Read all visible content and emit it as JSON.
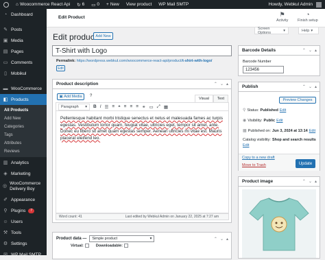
{
  "adminbar": {
    "site_name": "Woocommerce React Api",
    "updates_count": "6",
    "comments_count": "0",
    "new_label": "New",
    "view_product": "View product",
    "mail_plugin": "WP Mail SMTP",
    "howdy": "Howdy, Webkul Admin"
  },
  "sidebar": {
    "items": [
      {
        "label": "Dashboard",
        "icon": "dashboard-icon"
      },
      {
        "label": "Posts",
        "icon": "pin-icon"
      },
      {
        "label": "Media",
        "icon": "media-icon"
      },
      {
        "label": "Pages",
        "icon": "page-icon"
      },
      {
        "label": "Comments",
        "icon": "comment-icon"
      },
      {
        "label": "Mobikul",
        "icon": "mobikul-icon"
      },
      {
        "label": "WooCommerce",
        "icon": "woo-icon"
      },
      {
        "label": "Products",
        "icon": "products-icon"
      }
    ],
    "submenu": [
      "All Products",
      "Add New",
      "Categories",
      "Tags",
      "Attributes",
      "Reviews"
    ],
    "items_after": [
      {
        "label": "Analytics",
        "icon": "analytics-icon"
      },
      {
        "label": "Marketing",
        "icon": "marketing-icon"
      },
      {
        "label": "WooCommerce Delivery Boy",
        "icon": "delivery-icon"
      },
      {
        "label": "Appearance",
        "icon": "appearance-icon"
      },
      {
        "label": "Plugins",
        "icon": "plugins-icon",
        "badge": "7"
      },
      {
        "label": "Users",
        "icon": "users-icon"
      },
      {
        "label": "Tools",
        "icon": "tools-icon"
      },
      {
        "label": "Settings",
        "icon": "settings-icon"
      },
      {
        "label": "WP Mail SMTP",
        "icon": "mail-icon"
      }
    ]
  },
  "topbar": {
    "title": "Edit Product",
    "activity": "Activity",
    "finish_setup": "Finish setup"
  },
  "page": {
    "heading": "Edit product",
    "add_new": "Add New",
    "screen_options": "Screen Options",
    "help": "Help"
  },
  "post": {
    "title": "T-Shirt with Logo",
    "permalink_label": "Permalink:",
    "permalink_base": "https://wordpress.webkul.com/woocommerce-react-api/product/",
    "permalink_slug": "t-shirt-with-logo/",
    "edit_label": "Edit"
  },
  "description": {
    "heading": "Product description",
    "add_media": "Add Media",
    "tab_visual": "Visual",
    "tab_code": "Text",
    "format": "Paragraph",
    "body": "Pellentesque habitant morbi tristique senectus et netus et malesuada fames ac turpis egestas. Vestibulum tortor quam, feugiat vitae, ultricies eget, tempor sit amet, ante. Donec eu libero sit amet quam egestas semper. Aenean ultricies mi vitae est. Mauris placerat eleifend leo.",
    "word_count": "Word count: 41",
    "last_edited": "Last edited by Webkul Admin on January 22, 2025 at 7:27 am"
  },
  "product_data": {
    "label": "Product data —",
    "type": "Simple product",
    "virtual": "Virtual:",
    "downloadable": "Downloadable:"
  },
  "barcode": {
    "heading": "Barcode Details",
    "field_label": "Barcode Number",
    "value": "123456"
  },
  "publish": {
    "heading": "Publish",
    "preview": "Preview Changes",
    "status_label": "Status:",
    "status_value": "Published",
    "visibility_label": "Visibility:",
    "visibility_value": "Public",
    "published_label": "Published on:",
    "published_value": "Jun 3, 2024 at 13:14",
    "catalog_label": "Catalog visibility:",
    "catalog_value": "Shop and search results",
    "edit": "Edit",
    "copy_draft": "Copy to a new draft",
    "trash": "Move to Trash",
    "update": "Update"
  },
  "product_image": {
    "heading": "Product image"
  },
  "colors": {
    "accent": "#2271b1",
    "sidebar": "#1d2327",
    "shirt": "#8fcfc8"
  }
}
